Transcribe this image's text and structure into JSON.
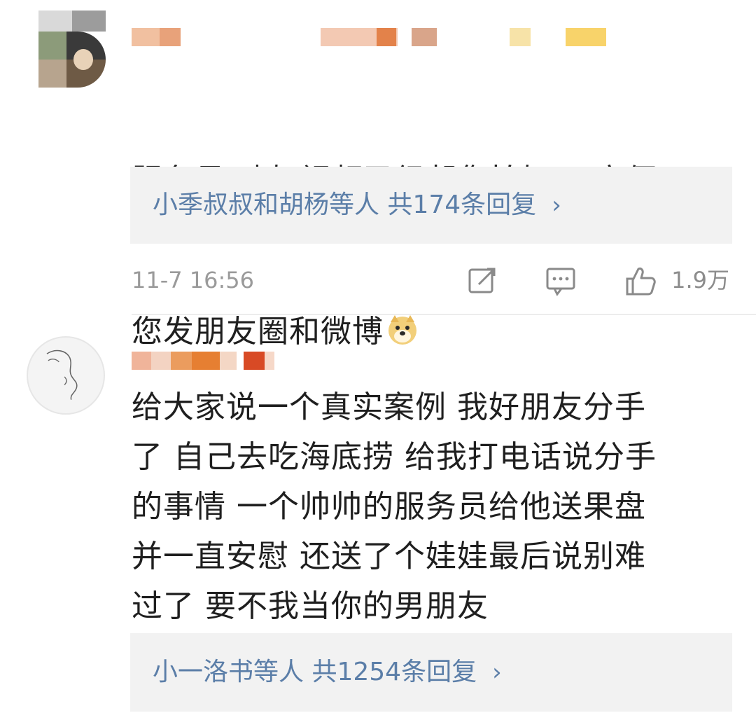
{
  "comments": [
    {
      "text_line1": "服务员:吵架视频已经帮您拍好了 方便",
      "text_line2": "您发朋友圈和微博",
      "emoji": "doge-emoji",
      "reply_who": "小季叔叔和胡杨等人",
      "reply_rest": " 共174条回复",
      "reply_chevron": "›",
      "time": "11-7 16:56",
      "like_count": "1.9万"
    },
    {
      "text": "给大家说一个真实案例 我好朋友分手\n了 自己去吃海底捞 给我打电话说分手\n的事情 一个帅帅的服务员给他送果盘\n并一直安慰 还送了个娃娃最后说别难\n过了 要不我当你的男朋友",
      "reply_who": "小一洛书等人",
      "reply_rest": " 共1254条回复",
      "reply_chevron": "›"
    }
  ],
  "icons": {
    "repost": "repost-icon",
    "comment": "comment-icon",
    "like": "thumbs-up-icon"
  },
  "colors": {
    "link_blue": "#5b7ea8",
    "reply_bg": "#f2f2f2",
    "meta_gray": "#9a9a9a"
  }
}
